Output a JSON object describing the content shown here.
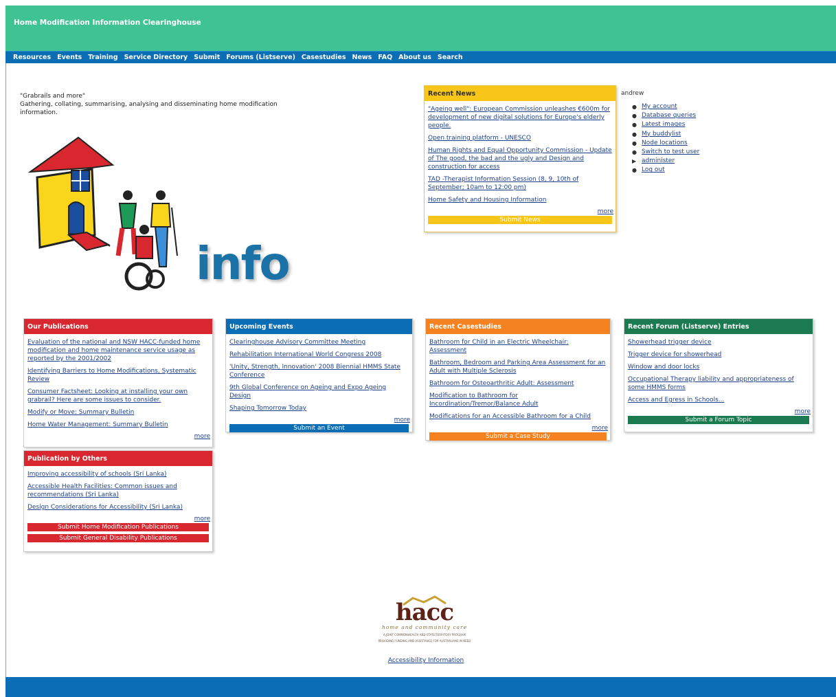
{
  "site": {
    "title": "Home Modification Information Clearinghouse"
  },
  "nav": [
    "Resources",
    "Events",
    "Training",
    "Service Directory",
    "Submit",
    "Forums (Listserve)",
    "Casestudies",
    "News",
    "FAQ",
    "About us",
    "Search"
  ],
  "tagline": {
    "quote": "\"Grabrails and more\"",
    "desc": "Gathering, collating, summarising, analysing and disseminating home modification information."
  },
  "logo": {
    "info_text": "info"
  },
  "recent_news": {
    "title": "Recent News",
    "items": [
      "\"Ageing well\": European Commission unleashes €600m for development of new digital solutions for Europe's elderly people.",
      "Open training platform - UNESCO",
      "Human Rights and Equal Opportunity Commission - Update of The good, the bad and the ugly and Design and construction for access",
      "TAD -Therapist Information Session (8, 9, 10th of September; 10am to 12:00 pm)",
      "Home Safety and Housing Information"
    ],
    "more": "more",
    "submit": "Submit News"
  },
  "user_menu": {
    "username": "andrew",
    "items": [
      "My account",
      "Database queries",
      "Latest images",
      "My buddylist",
      "Node locations",
      "Switch to test user",
      "administer",
      "Log out"
    ]
  },
  "publications": {
    "title": "Our Publications",
    "items": [
      "Evaluation of the national and NSW HACC-funded home modification and home maintenance service usage as reported by the 2001/2002",
      "Identifying Barriers to Home Modifications, Systematic Review",
      "Consumer Factsheet: Looking at installing your own grabrail? Here are some issues to consider.",
      "Modify or Move: Summary Bulletin",
      "Home Water Management: Summary Bulletin"
    ],
    "more": "more"
  },
  "others": {
    "title": "Publication by Others",
    "items": [
      "Improving accessibility of schools (Sri Lanka)",
      "Accessible Health Facilities: Common issues and recommendations (Sri Lanka)",
      "Design Considerations for Accessibility (Sri Lanka)"
    ],
    "more": "more",
    "submit_home": "Submit Home Modification Publications",
    "submit_general": "Submit General Disability Publications"
  },
  "events": {
    "title": "Upcoming Events",
    "items": [
      "Clearinghouse Advisory Committee Meeting",
      "Rehabilitation International World Congress 2008",
      "'Unity, Strength, Innovation' 2008 Biennial HMMS State Conference",
      "9th Global Conference on Ageing and Expo Ageing Design",
      "Shaping Tomorrow Today"
    ],
    "more": "more",
    "submit": "Submit an Event"
  },
  "casestudies": {
    "title": "Recent Casestudies",
    "items": [
      "Bathroom for Child in an Electric Wheelchair: Assessment",
      "Bathroom, Bedroom and Parking Area Assessment for an Adult with Multiple Sclerosis",
      "Bathroom for Osteoarthritic Adult: Assessment",
      "Modification to Bathroom for Incordination/Tremor/Balance Adult",
      "Modifications for an Accessible Bathroom for a Child"
    ],
    "more": "more",
    "submit": "Submit a Case Study"
  },
  "forum": {
    "title": "Recent Forum (Listserve) Entries",
    "items": [
      "Showerhead trigger device",
      "Trigger device for showerhead",
      "Window and door locks",
      "Occupational Therapy liability and appropriateness of some HMMS forms",
      "Access and Egress in Schools..."
    ],
    "more": "more",
    "submit": "Submit a Forum Topic"
  },
  "hacc": {
    "word": "hacc",
    "subtitle": "home and community care",
    "fine1": "A JOINT COMMONWEALTH AND STATE/TERRITORY PROGRAM",
    "fine2": "PROVIDING FUNDING AND ASSISTANCE FOR AUSTRALIANS IN NEED"
  },
  "footer": {
    "accessibility": "Accessibility Information"
  },
  "colors": {
    "header_green": "#3fc393",
    "nav_blue": "#0b6db3",
    "news_yellow": "#f7c619",
    "pub_red": "#d8272e",
    "case_orange": "#f58220",
    "forum_green": "#1b7a50",
    "link": "#1d3f8c"
  }
}
